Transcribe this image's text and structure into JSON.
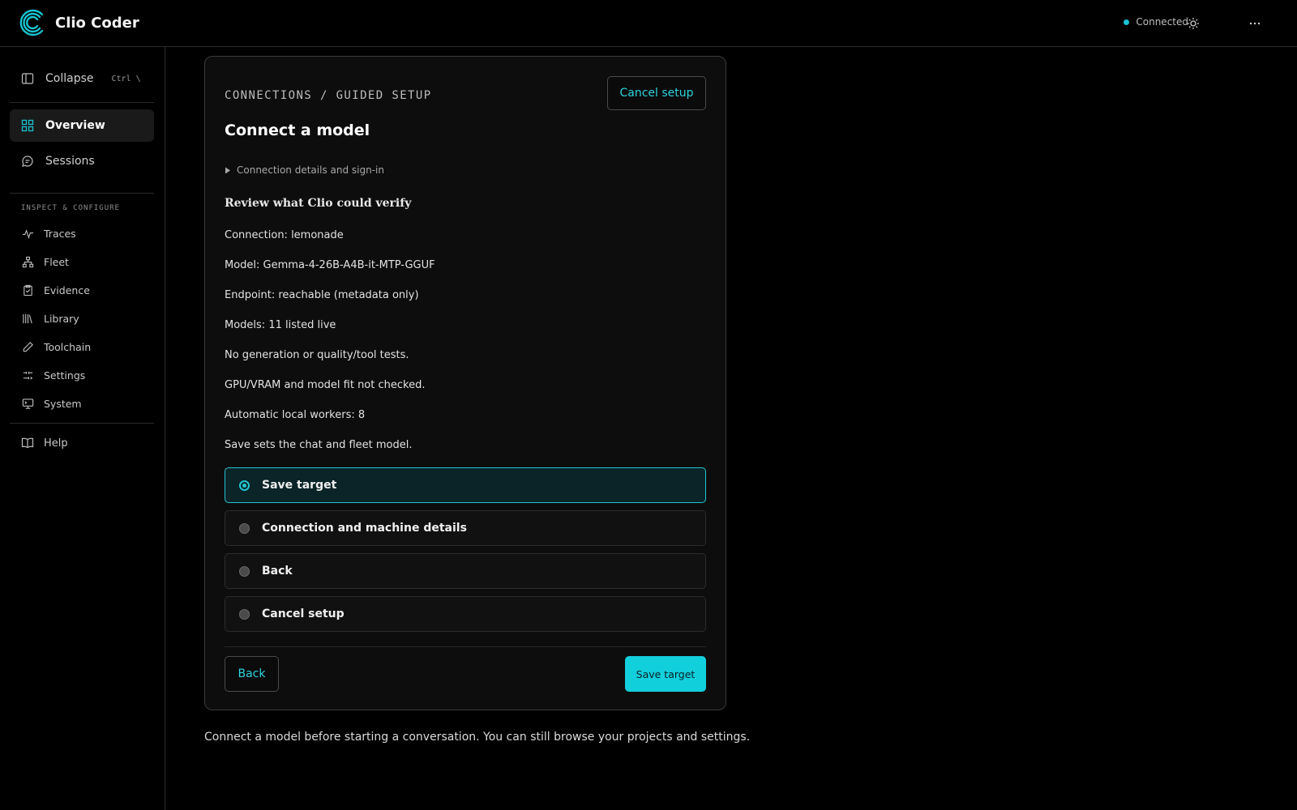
{
  "app": {
    "name": "Clio Coder"
  },
  "header": {
    "status": "Connected",
    "icons": {
      "theme": "sun-icon",
      "more": "more-horizontal-icon"
    },
    "accent": "#19c3d0"
  },
  "sidebar": {
    "collapse": {
      "label": "Collapse",
      "shortcut": "Ctrl \\"
    },
    "primary": [
      {
        "label": "Overview",
        "icon": "grid-icon",
        "active": true
      },
      {
        "label": "Sessions",
        "icon": "chat-bubble-icon",
        "active": false
      }
    ],
    "section_label": "INSPECT & CONFIGURE",
    "secondary": [
      {
        "label": "Traces",
        "icon": "activity-icon"
      },
      {
        "label": "Fleet",
        "icon": "network-icon"
      },
      {
        "label": "Evidence",
        "icon": "clipboard-icon"
      },
      {
        "label": "Library",
        "icon": "books-icon"
      },
      {
        "label": "Toolchain",
        "icon": "pencil-icon"
      },
      {
        "label": "Settings",
        "icon": "sliders-icon"
      },
      {
        "label": "System",
        "icon": "monitor-icon"
      }
    ],
    "help": {
      "label": "Help",
      "icon": "book-open-icon"
    }
  },
  "card": {
    "breadcrumb": "CONNECTIONS / GUIDED SETUP",
    "cancel_label": "Cancel setup",
    "title": "Connect a model",
    "details_toggle": "Connection details and sign-in",
    "review_heading": "Review what Clio could verify",
    "info_lines": [
      "Connection: lemonade",
      "Model: Gemma-4-26B-A4B-it-MTP-GGUF",
      "Endpoint: reachable (metadata only)",
      "Models: 11 listed live",
      "No generation or quality/tool tests.",
      "GPU/VRAM and model fit not checked.",
      "Automatic local workers: 8",
      "Save sets the chat and fleet model."
    ],
    "options": [
      {
        "label": "Save target",
        "selected": true
      },
      {
        "label": "Connection and machine details",
        "selected": false
      },
      {
        "label": "Back",
        "selected": false
      },
      {
        "label": "Cancel setup",
        "selected": false
      }
    ],
    "back_label": "Back",
    "save_label": "Save target"
  },
  "footer_note": "Connect a model before starting a conversation. You can still browse your projects and settings."
}
